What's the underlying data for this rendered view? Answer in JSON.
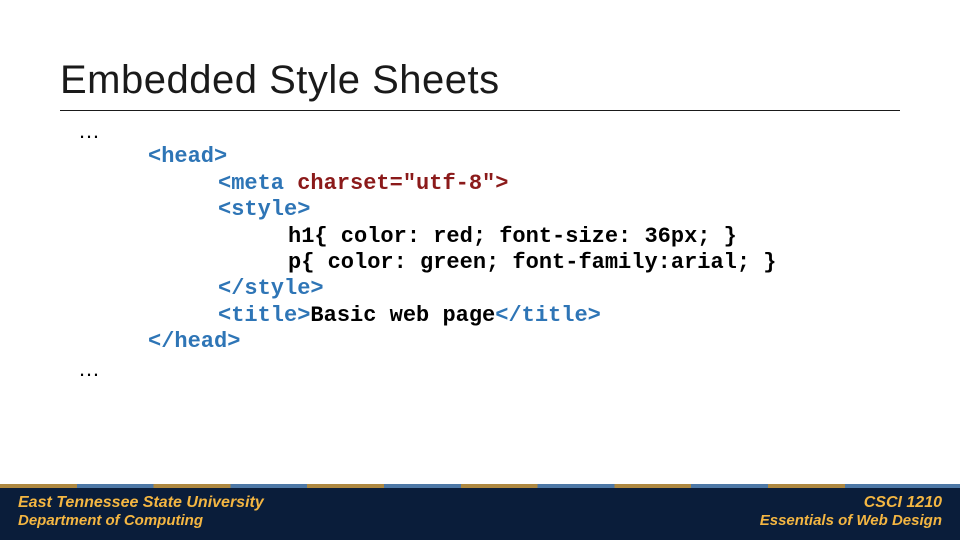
{
  "title": "Embedded Style Sheets",
  "code": {
    "ellipsis": "…",
    "head_open": "<head>",
    "meta_open": "<meta ",
    "meta_attr": "charset=\"utf-8\">",
    "style_open": "<style>",
    "rule_h1": "h1{ color: red; font-size: 36px; }",
    "rule_p": "p{ color: green; font-family:arial; }",
    "style_close": "</style>",
    "title_open": "<title>",
    "title_text": "Basic web page",
    "title_close": "</title>",
    "head_close": "</head>"
  },
  "footer": {
    "left1": "East Tennessee State University",
    "left2": "Department of Computing",
    "right1": "CSCI 1210",
    "right2": "Essentials of Web Design"
  }
}
